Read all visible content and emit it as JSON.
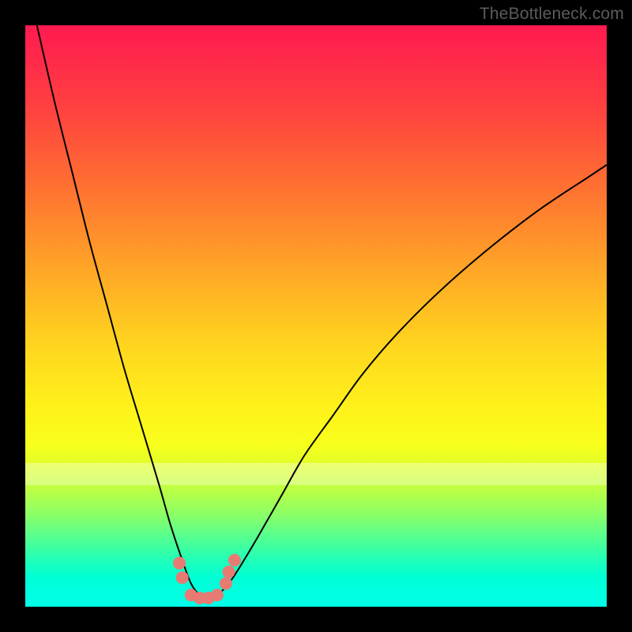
{
  "attribution": "TheBottleneck.com",
  "chart_data": {
    "type": "line",
    "title": "",
    "xlabel": "",
    "ylabel": "",
    "xlim": [
      0,
      100
    ],
    "ylim": [
      0,
      100
    ],
    "series": [
      {
        "name": "bottleneck-curve",
        "x": [
          2,
          5,
          8,
          11,
          14,
          17,
          20,
          23,
          25,
          27,
          28.5,
          30,
          31.5,
          33,
          35,
          37,
          40,
          44,
          48,
          53,
          58,
          64,
          71,
          79,
          88,
          97,
          100
        ],
        "values": [
          100,
          87,
          75,
          63,
          52,
          41,
          31,
          21,
          14,
          8,
          4,
          2,
          1.5,
          2,
          4,
          7,
          12,
          19,
          26,
          33,
          40,
          47,
          54,
          61,
          68,
          74,
          76
        ]
      }
    ],
    "markers": {
      "name": "highlight-dots",
      "x": [
        26.5,
        27,
        28.5,
        30,
        31.5,
        33,
        34.5,
        35,
        36
      ],
      "values": [
        7.5,
        5,
        2,
        1.5,
        1.5,
        2,
        4,
        6,
        8
      ]
    }
  }
}
